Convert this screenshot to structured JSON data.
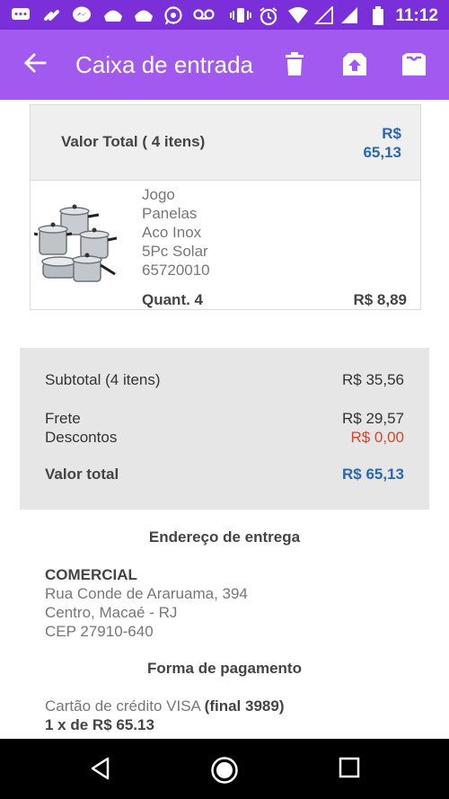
{
  "status_bar": {
    "time": "11:12"
  },
  "app_bar": {
    "title": "Caixa de entrada"
  },
  "order": {
    "total_label": "Valor Total ( 4 itens)",
    "total_currency": "R$",
    "total_value": "65,13",
    "product": {
      "name_lines": [
        "Jogo",
        "Panelas",
        "Aco Inox",
        "5Pc Solar",
        "65720010"
      ],
      "quantity": "Quant. 4",
      "unit_price": "R$ 8,89"
    }
  },
  "summary": {
    "subtotal_label": "Subtotal (4 itens)",
    "subtotal_value": "R$ 35,56",
    "frete_label": "Frete",
    "frete_value": "R$ 29,57",
    "descontos_label": "Descontos",
    "descontos_value": "R$ 0,00",
    "total_label": "Valor total",
    "total_value": "R$ 65,13"
  },
  "address": {
    "heading": "Endereço de entrega",
    "name": "COMERCIAL",
    "lines": [
      "Rua Conde de Araruama, 394",
      "Centro, Macaé - RJ",
      "CEP 27910-640"
    ]
  },
  "payment": {
    "heading": "Forma de pagamento",
    "method": "Cartão de crédito VISA",
    "card": "(final 3989)",
    "installments": "1 x de R$ 65.13"
  },
  "colors": {
    "status_bar": "#7b2fd9",
    "app_bar": "#a259f0",
    "price_blue": "#2a66b4",
    "discount_red": "#e0412b"
  }
}
